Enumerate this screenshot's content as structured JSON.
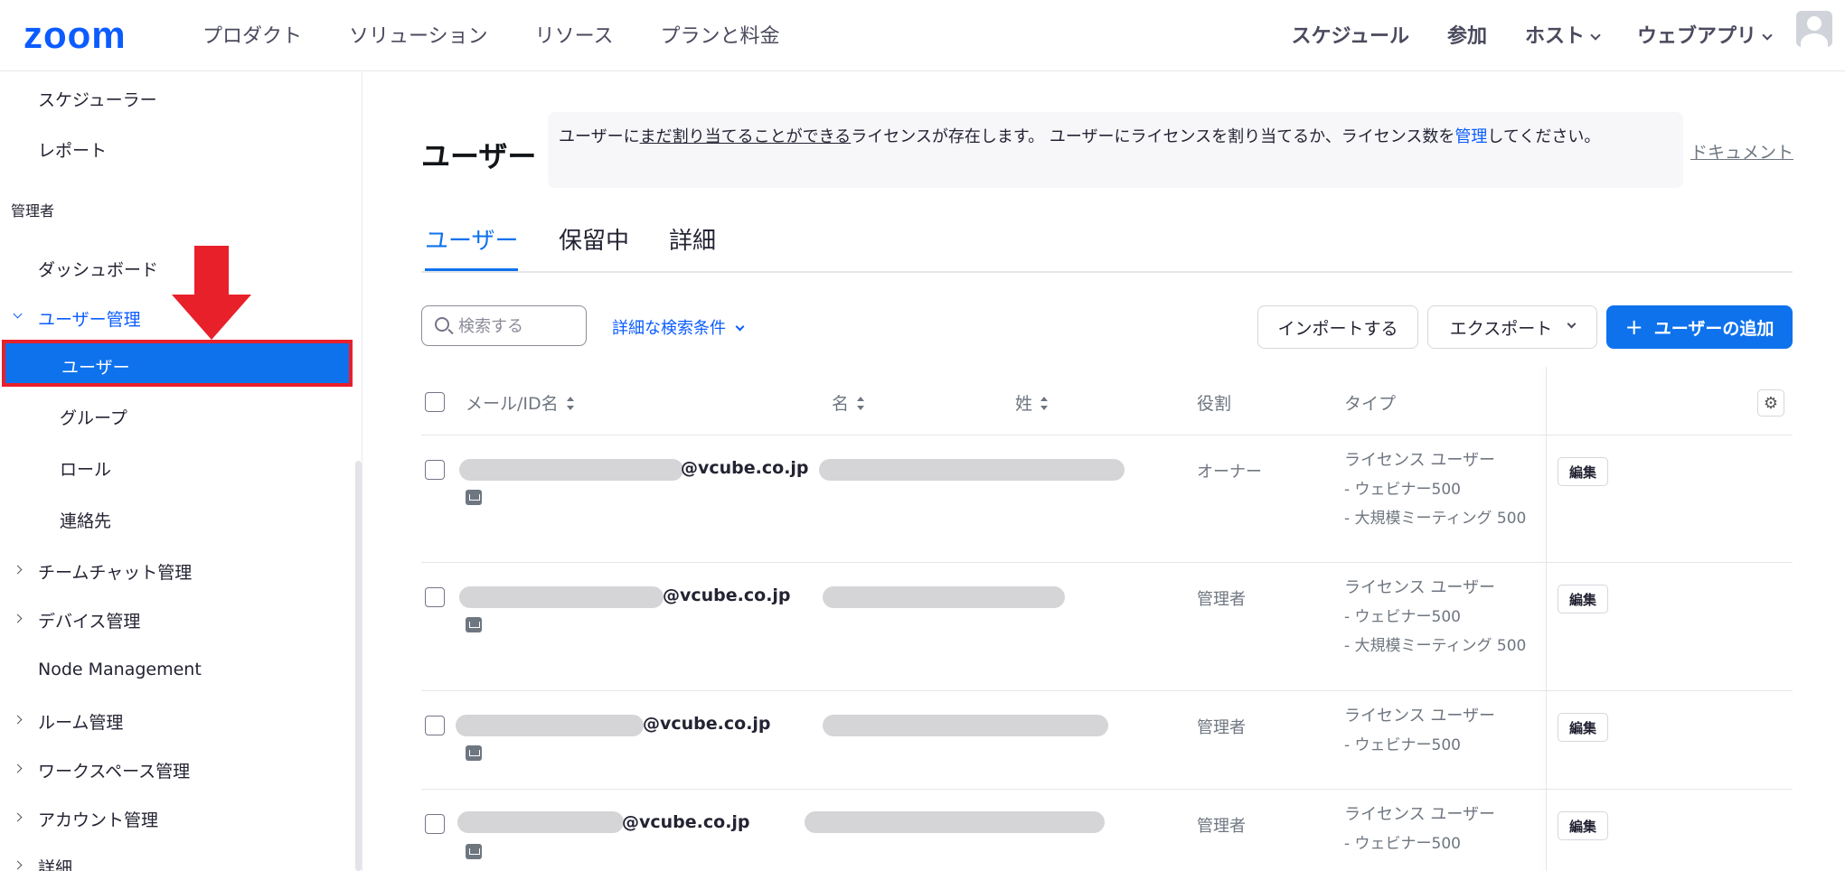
{
  "topbar": {
    "logo": "zoom",
    "nav_left": [
      "プロダクト",
      "ソリューション",
      "リソース",
      "プランと料金"
    ],
    "nav_right": {
      "schedule": "スケジュール",
      "join": "参加",
      "host": "ホスト",
      "web_app": "ウェブアプリ"
    }
  },
  "sidebar": {
    "scheduler": "スケジューラー",
    "report": "レポート",
    "admin_header": "管理者",
    "dashboard": "ダッシュボード",
    "user_management": "ユーザー管理",
    "users": "ユーザー",
    "groups": "グループ",
    "roles": "ロール",
    "contacts": "連絡先",
    "team_chat": "チームチャット管理",
    "device": "デバイス管理",
    "node": "Node Management",
    "room": "ルーム管理",
    "workspace": "ワークスペース管理",
    "account": "アカウント管理",
    "details": "詳細"
  },
  "main": {
    "title": "ユーザー",
    "notice": {
      "part1": "ユーザーに",
      "underlined": "まだ割り当てることができる",
      "part2": "ライセンスが存在します。 ユーザーにライセンスを割り当てるか、ライセンス数を",
      "link": "管理",
      "part3": "してください。"
    },
    "doc_link": "ドキュメント",
    "tabs": [
      "ユーザー",
      "保留中",
      "詳細"
    ],
    "search_placeholder": "検索する",
    "advanced_search": "詳細な検索条件",
    "import_button": "インポートする",
    "export_button": "エクスポート",
    "add_user_button": "ユーザーの追加",
    "table": {
      "headers": {
        "email": "メール/ID名",
        "first_name": "名",
        "last_name": "姓",
        "role": "役割",
        "type": "タイプ"
      },
      "edit_label": "編集",
      "rows": [
        {
          "email_domain": "@vcube.co.jp",
          "role": "オーナー",
          "license": "ライセンス ユーザー",
          "sub": [
            "- ウェビナー500",
            "- 大規模ミーティング 500"
          ]
        },
        {
          "email_domain": "@vcube.co.jp",
          "role": "管理者",
          "license": "ライセンス ユーザー",
          "sub": [
            "- ウェビナー500",
            "- 大規模ミーティング 500"
          ]
        },
        {
          "email_domain": "@vcube.co.jp",
          "role": "管理者",
          "license": "ライセンス ユーザー",
          "sub": [
            "- ウェビナー500"
          ]
        },
        {
          "email_domain": "@vcube.co.jp",
          "role": "管理者",
          "license": "ライセンス ユーザー",
          "sub": [
            "- ウェビナー500"
          ]
        }
      ]
    }
  },
  "colors": {
    "brand": "#0b5cff",
    "active_bg": "#0e72ed",
    "highlight": "#e8202a"
  }
}
